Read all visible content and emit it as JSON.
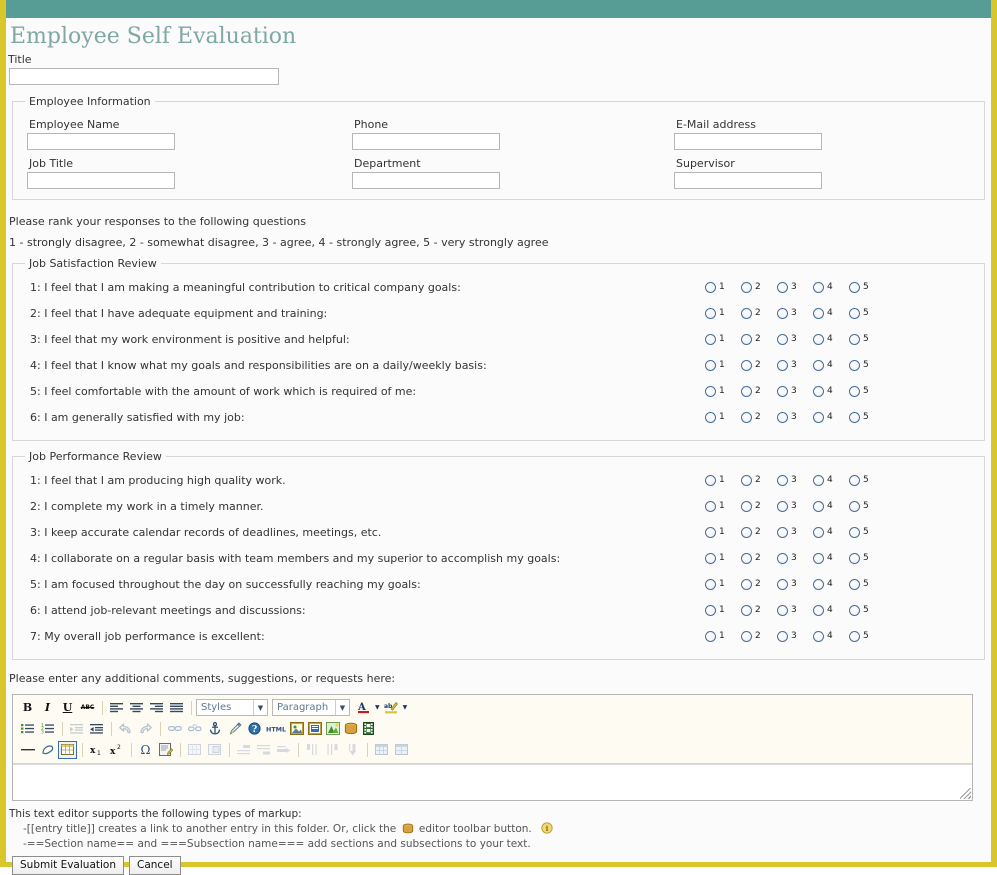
{
  "theme": {
    "accent_border": "#d9c62b",
    "header_bar": "#589c96",
    "title_color": "#7fa8a4",
    "radio_border": "#4a6c95"
  },
  "page_title": "Employee Self Evaluation",
  "title_field": {
    "label": "Title",
    "value": "",
    "placeholder": ""
  },
  "employee_information": {
    "legend": "Employee Information",
    "fields": [
      {
        "label": "Employee Name",
        "value": "",
        "name": "employee-name"
      },
      {
        "label": "Phone",
        "value": "",
        "name": "phone"
      },
      {
        "label": "E-Mail address",
        "value": "",
        "name": "email-address"
      },
      {
        "label": "Job Title",
        "value": "",
        "name": "job-title"
      },
      {
        "label": "Department",
        "value": "",
        "name": "department"
      },
      {
        "label": "Supervisor",
        "value": "",
        "name": "supervisor"
      }
    ]
  },
  "instructions": {
    "line1": "Please rank your responses to the following questions",
    "line2": "1 - strongly disagree, 2 - somewhat disagree, 3 - agree, 4 - strongly agree, 5 - very strongly agree"
  },
  "scale": [
    "1",
    "2",
    "3",
    "4",
    "5"
  ],
  "job_satisfaction": {
    "legend": "Job Satisfaction Review",
    "questions": [
      "1: I feel that I am making a meaningful contribution to critical company goals:",
      "2: I feel that I have adequate equipment and training:",
      "3: I feel that my work environment is positive and helpful:",
      "4: I feel that I know what my goals and responsibilities are on a daily/weekly basis:",
      "5: I feel comfortable with the amount of work which is required of me:",
      "6: I am generally satisfied with my job:"
    ]
  },
  "job_performance": {
    "legend": "Job Performance Review",
    "questions": [
      "1: I feel that I am producing high quality work.",
      "2: I complete my work in a timely manner.",
      "3: I keep accurate calendar records of deadlines, meetings, etc.",
      "4: I collaborate on a regular basis with team members and my superior to accomplish my goals:",
      "5: I am focused throughout the day on successfully reaching my goals:",
      "6: I attend job-relevant meetings and discussions:",
      "7: My overall job performance is excellent:"
    ]
  },
  "comments": {
    "label": "Please enter any additional comments, suggestions, or requests here:",
    "value": ""
  },
  "editor": {
    "styles_select": {
      "value": "Styles",
      "options": [
        "Styles"
      ]
    },
    "format_select": {
      "value": "Paragraph",
      "options": [
        "Paragraph"
      ]
    },
    "row1": [
      {
        "name": "bold-icon",
        "glyph": "B"
      },
      {
        "name": "italic-icon",
        "glyph": "I"
      },
      {
        "name": "underline-icon",
        "glyph": "U"
      },
      {
        "name": "strikethrough-icon",
        "glyph": "ABC"
      },
      {
        "name": "align-left-icon",
        "glyph": ""
      },
      {
        "name": "align-center-icon",
        "glyph": ""
      },
      {
        "name": "align-right-icon",
        "glyph": ""
      },
      {
        "name": "align-justify-icon",
        "glyph": ""
      }
    ],
    "row2": [
      {
        "name": "bulleted-list-icon"
      },
      {
        "name": "numbered-list-icon"
      },
      {
        "name": "decrease-indent-icon"
      },
      {
        "name": "increase-indent-icon"
      },
      {
        "name": "undo-icon"
      },
      {
        "name": "redo-icon"
      },
      {
        "name": "link-icon"
      },
      {
        "name": "unlink-icon"
      },
      {
        "name": "anchor-icon"
      },
      {
        "name": "remove-format-icon"
      },
      {
        "name": "help-icon"
      },
      {
        "name": "source-html-icon",
        "glyph": "HTML"
      },
      {
        "name": "insert-image-icon"
      },
      {
        "name": "insert-file-icon"
      },
      {
        "name": "insert-picture-icon"
      },
      {
        "name": "internal-link-icon"
      },
      {
        "name": "insert-media-icon"
      }
    ],
    "row3": [
      {
        "name": "horizontal-rule-icon"
      },
      {
        "name": "eraser-icon"
      },
      {
        "name": "insert-table-icon"
      },
      {
        "name": "subscript-icon",
        "glyph": "x"
      },
      {
        "name": "superscript-icon",
        "glyph": "x"
      },
      {
        "name": "special-character-icon",
        "glyph": "Ω"
      },
      {
        "name": "edit-source-icon"
      },
      {
        "name": "table-cell-properties-icon"
      },
      {
        "name": "merge-cells-icon"
      },
      {
        "name": "insert-row-before-icon"
      },
      {
        "name": "insert-row-after-icon"
      },
      {
        "name": "delete-row-icon"
      },
      {
        "name": "insert-column-before-icon"
      },
      {
        "name": "insert-column-after-icon"
      },
      {
        "name": "delete-column-icon"
      },
      {
        "name": "table-properties-icon"
      },
      {
        "name": "delete-table-icon"
      }
    ]
  },
  "help": {
    "line1": "This text editor supports the following types of markup:",
    "line2_pre": "-[[entry title]] creates a link to another entry in this folder. Or, click the",
    "line2_post": "editor toolbar button.",
    "line3": "-==Section name== and ===Subsection name=== add sections and subsections to your text."
  },
  "actions": {
    "submit": "Submit Evaluation",
    "cancel": "Cancel"
  }
}
